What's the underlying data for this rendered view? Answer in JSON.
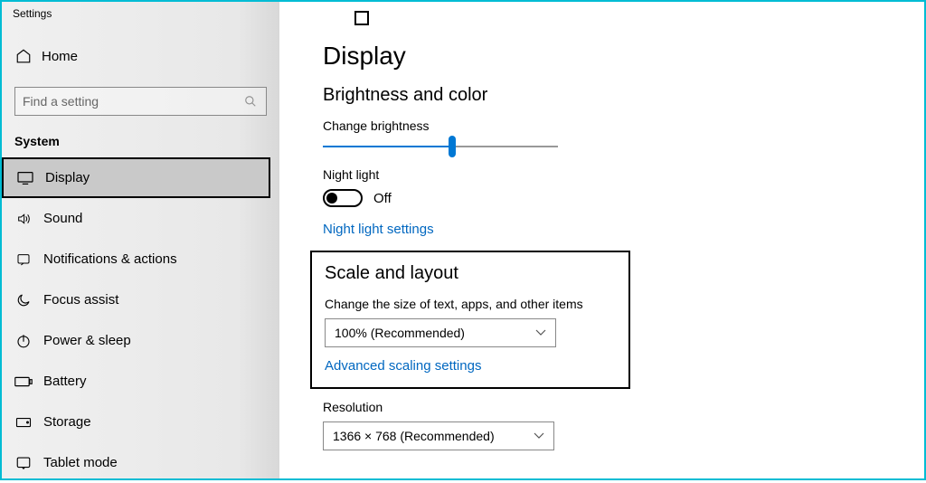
{
  "app_title": "Settings",
  "home_label": "Home",
  "search_placeholder": "Find a setting",
  "category": "System",
  "nav": {
    "display": "Display",
    "sound": "Sound",
    "notifications": "Notifications & actions",
    "focus": "Focus assist",
    "power": "Power & sleep",
    "battery": "Battery",
    "storage": "Storage",
    "tablet": "Tablet mode"
  },
  "page_title": "Display",
  "section_brightness": "Brightness and color",
  "brightness": {
    "label": "Change brightness",
    "percent": 55
  },
  "night_light": {
    "label": "Night light",
    "state": "Off",
    "settings_link": "Night light settings"
  },
  "scale": {
    "section": "Scale and layout",
    "size_label": "Change the size of text, apps, and other items",
    "size_value": "100% (Recommended)",
    "advanced_link": "Advanced scaling settings"
  },
  "resolution": {
    "label": "Resolution",
    "value": "1366 × 768 (Recommended)"
  }
}
